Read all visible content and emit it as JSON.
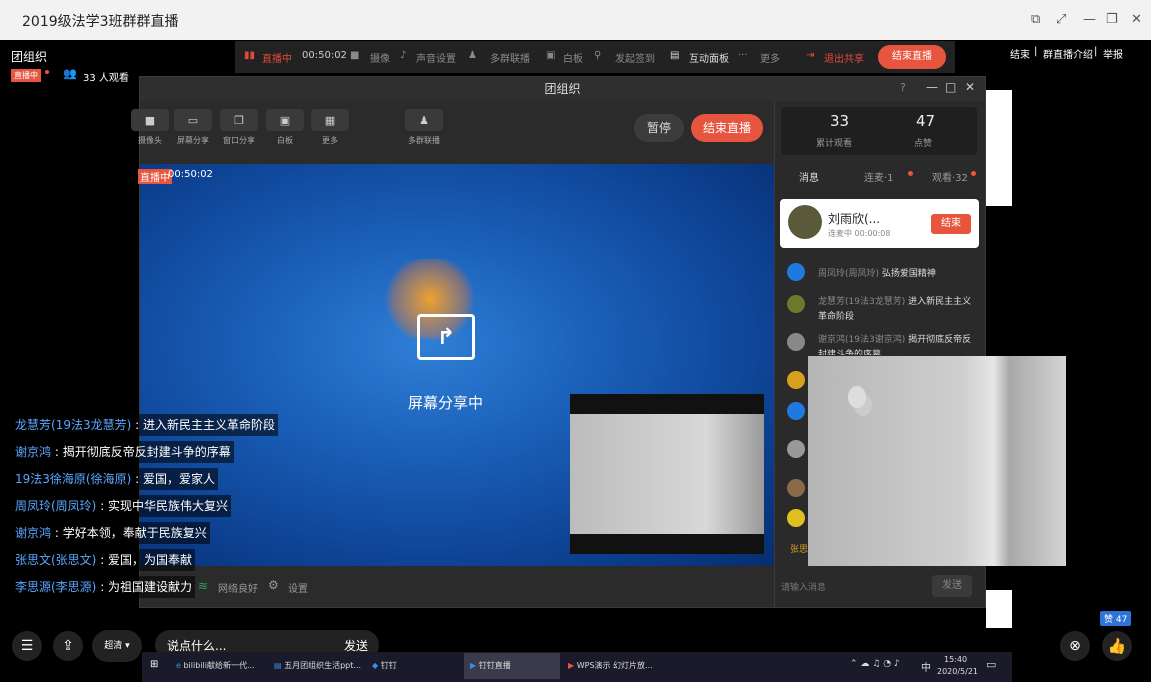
{
  "window": {
    "title": "2019级法学3班群群直播"
  },
  "host": {
    "name": "团组织",
    "live_badge": "直播中",
    "viewers": "33 人观看"
  },
  "top_links": {
    "end": "结束",
    "intro": "群直播介绍",
    "report": "举报",
    "sep": "|"
  },
  "host_bar": {
    "live": "直播中",
    "time": "00:50:02",
    "camera": "摄像",
    "audio": "声音设置",
    "multi": "多群联播",
    "whiteboard": "白板",
    "checkin": "发起签到",
    "interact": "互动面板",
    "more": "更多",
    "exit_share": "退出共享",
    "end_live": "结束直播"
  },
  "panel": {
    "title": "团组织",
    "tools": [
      {
        "label": "摄像头",
        "icon": "■"
      },
      {
        "label": "屏幕分享",
        "icon": "▭"
      },
      {
        "label": "窗口分享",
        "icon": "❐"
      },
      {
        "label": "白板",
        "icon": "▣"
      },
      {
        "label": "更多",
        "icon": "▦"
      },
      {
        "label": "多群联播",
        "icon": "♟"
      }
    ],
    "pause": "暂停",
    "end_live": "结束直播",
    "live_badge": "直播中",
    "time": "00:50:02",
    "sharing": "屏幕分享中",
    "stats": {
      "views": "33",
      "views_label": "累计观看",
      "likes": "47",
      "likes_label": "点赞"
    },
    "tabs": {
      "messages": "消息",
      "linkmic": "连麦·1",
      "watch": "观看·32"
    },
    "linkmic_user": {
      "name": "刘雨欣(...",
      "status": "连麦中 00:00:08",
      "end": "结束"
    },
    "messages": [
      {
        "name": "周凤玲(周凤玲)",
        "text": "弘扬爱国精神"
      },
      {
        "name": "龙慧芳(19法3龙慧芳)",
        "text": "进入新民主主义革命阶段"
      },
      {
        "name": "谢京鸿(19法3谢京鸿)",
        "text": "揭开彻底反帝反封建斗争的序幕"
      }
    ],
    "partial_name": "张思",
    "net": "网络良好",
    "settings": "设置",
    "input_placeholder": "请输入消息",
    "send": "发送"
  },
  "chat": [
    {
      "name": "龙慧芳(19法3龙慧芳)",
      "text": " : 进入新民主主义革命阶段"
    },
    {
      "name": "谢京鸿",
      "text": " : 揭开彻底反帝反封建斗争的序幕"
    },
    {
      "name": "19法3徐海原(徐海原)",
      "text": " : 爱国，爱家人"
    },
    {
      "name": "周凤玲(周凤玲)",
      "text": " : 实现中华民族伟大复兴"
    },
    {
      "name": "谢京鸿",
      "text": " : 学好本领，奉献于民族复兴"
    },
    {
      "name": "张思文(张思文)",
      "text": " : 爱国，为国奉献"
    },
    {
      "name": "李思源(李思源)",
      "text": " : 为祖国建设献力"
    }
  ],
  "bottom": {
    "quality": "超清",
    "input_placeholder": "说点什么...",
    "send": "发送",
    "likes": "赞 47"
  },
  "taskbar": {
    "apps": [
      {
        "label": "bilibili献给新一代..."
      },
      {
        "label": "五月团组织生活ppt..."
      },
      {
        "label": "钉钉"
      },
      {
        "label": "钉钉直播"
      },
      {
        "label": "WPS演示 幻灯片放..."
      }
    ],
    "ime": "中",
    "time": "15:40",
    "date": "2020/5/21"
  }
}
